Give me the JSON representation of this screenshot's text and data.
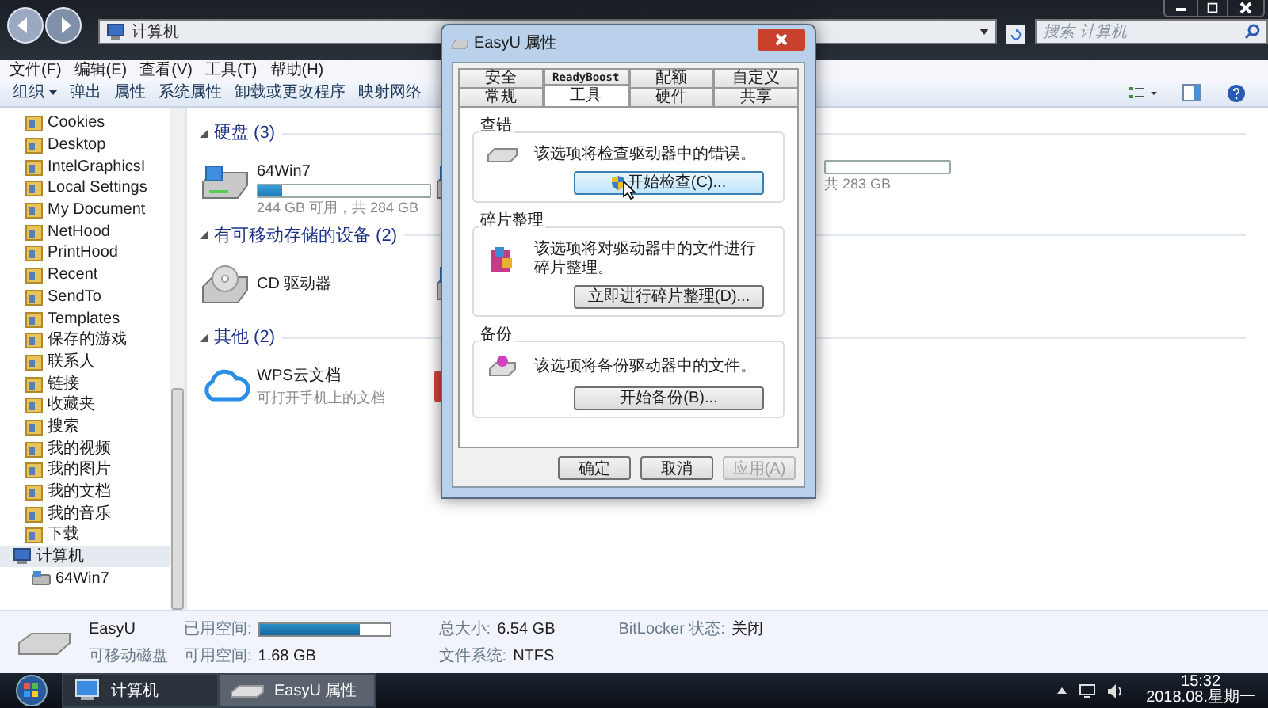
{
  "window": {
    "breadcrumb": "计算机",
    "search": {
      "placeholder": "搜索 计算机"
    }
  },
  "menu": [
    "文件(F)",
    "编辑(E)",
    "查看(V)",
    "工具(T)",
    "帮助(H)"
  ],
  "toolbar": [
    {
      "label": "组织",
      "kind": "dropdown"
    },
    {
      "label": "弹出",
      "kind": "button"
    },
    {
      "label": "属性",
      "kind": "button"
    },
    {
      "label": "系统属性",
      "kind": "button"
    },
    {
      "label": "卸载或更改程序",
      "kind": "button"
    },
    {
      "label": "映射网络",
      "kind": "button"
    }
  ],
  "sidebar": {
    "items": [
      {
        "label": "Cookies",
        "kind": "folder",
        "selected": false
      },
      {
        "label": "Desktop",
        "kind": "folder",
        "selected": false
      },
      {
        "label": "IntelGraphicsI",
        "kind": "folder",
        "selected": false
      },
      {
        "label": "Local Settings",
        "kind": "folder",
        "selected": false
      },
      {
        "label": "My Document",
        "kind": "folder",
        "selected": false
      },
      {
        "label": "NetHood",
        "kind": "folder",
        "selected": false
      },
      {
        "label": "PrintHood",
        "kind": "folder",
        "selected": false
      },
      {
        "label": "Recent",
        "kind": "folder",
        "selected": false
      },
      {
        "label": "SendTo",
        "kind": "folder",
        "selected": false
      },
      {
        "label": "Templates",
        "kind": "folder",
        "selected": false
      },
      {
        "label": "保存的游戏",
        "kind": "folder",
        "selected": false
      },
      {
        "label": "联系人",
        "kind": "folder",
        "selected": false
      },
      {
        "label": "链接",
        "kind": "folder",
        "selected": false
      },
      {
        "label": "收藏夹",
        "kind": "folder",
        "selected": false
      },
      {
        "label": "搜索",
        "kind": "folder",
        "selected": false
      },
      {
        "label": "我的视频",
        "kind": "folder",
        "selected": false
      },
      {
        "label": "我的图片",
        "kind": "folder",
        "selected": false
      },
      {
        "label": "我的文档",
        "kind": "folder",
        "selected": false
      },
      {
        "label": "我的音乐",
        "kind": "folder",
        "selected": false
      },
      {
        "label": "下载",
        "kind": "folder",
        "selected": false
      },
      {
        "label": "计算机",
        "kind": "computer",
        "selected": true,
        "children": [
          {
            "label": "64Win7",
            "kind": "drive",
            "selected": false
          }
        ]
      }
    ]
  },
  "groups": [
    {
      "title": "硬盘 (3)",
      "items": [
        {
          "kind": "drive",
          "name": "64Win7",
          "level": 0.14,
          "free": "244 GB 可用，共 284 GB"
        },
        {
          "kind": "drive"
        },
        {
          "kind": "drive",
          "free": "共 283 GB"
        }
      ]
    },
    {
      "title": "有可移动存储的设备 (2)",
      "items": [
        {
          "kind": "cd",
          "name": "CD 驱动器"
        },
        {
          "kind": "drive"
        }
      ]
    },
    {
      "title": "其他 (2)",
      "items": [
        {
          "kind": "cloud",
          "name": "WPS云文档",
          "free": "可打开手机上的文档"
        },
        {
          "kind": "app"
        }
      ]
    }
  ],
  "details": {
    "name": "EasyU",
    "type": "可移动磁盘",
    "fields": [
      {
        "kind": "bar",
        "label": "已用空间:",
        "level": 0.77
      },
      {
        "kind": "text",
        "label": "可用空间:",
        "value": "1.68 GB"
      },
      {
        "kind": "text",
        "label": "总大小:",
        "value": "6.54 GB"
      },
      {
        "kind": "text",
        "label": "文件系统:",
        "value": "NTFS"
      },
      {
        "kind": "text",
        "label": "BitLocker 状态:",
        "value": "关闭"
      }
    ]
  },
  "dialog": {
    "title": "EasyU 属性",
    "tabs": [
      [
        {
          "label": "安全",
          "selected": false
        },
        {
          "label": "ReadyBoost",
          "selected": false
        },
        {
          "label": "配额",
          "selected": false
        },
        {
          "label": "自定义",
          "selected": false
        }
      ],
      [
        {
          "label": "常规",
          "selected": false
        },
        {
          "label": "工具",
          "selected": true
        },
        {
          "label": "硬件",
          "selected": false
        },
        {
          "label": "共享",
          "selected": false
        }
      ]
    ],
    "sections": [
      {
        "title": "查错",
        "kind": "check",
        "text": "该选项将检查驱动器中的错误。",
        "button": {
          "label": "开始检查(C)...",
          "hover": true,
          "shield": true
        }
      },
      {
        "title": "碎片整理",
        "kind": "defrag",
        "text": "该选项将对驱动器中的文件进行碎片整理。",
        "button": {
          "label": "立即进行碎片整理(D)...",
          "hover": false,
          "shield": false
        }
      },
      {
        "title": "备份",
        "kind": "backup",
        "text": "该选项将备份驱动器中的文件。",
        "button": {
          "label": "开始备份(B)...",
          "hover": false,
          "shield": false
        }
      }
    ],
    "buttons": [
      {
        "label": "确定",
        "disabled": false
      },
      {
        "label": "取消",
        "disabled": false
      },
      {
        "label": "应用(A)",
        "disabled": true
      }
    ]
  },
  "taskbar": {
    "buttons": [
      {
        "label": "计算机",
        "kind": "computer",
        "selected": false
      },
      {
        "label": "EasyU 属性",
        "kind": "drive",
        "selected": true
      }
    ],
    "tray": {
      "time": "15:32",
      "date": "2018.08.星期一"
    }
  }
}
